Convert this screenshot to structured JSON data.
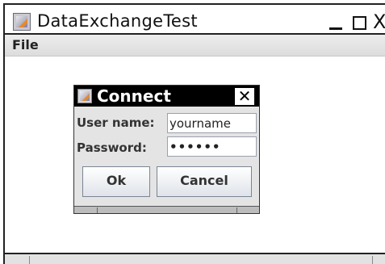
{
  "window": {
    "title": "DataExchangeTest",
    "close_glyph": "X",
    "controls": [
      "minimize-icon",
      "maximize-icon",
      "close-icon"
    ]
  },
  "menubar": {
    "items": [
      {
        "label": "File"
      }
    ]
  },
  "dialog": {
    "title": "Connect",
    "close_glyph": "✕",
    "user_label": "User name:",
    "user_value": "yourname",
    "password_label": "Password:",
    "password_value": "••••••",
    "ok_label": "Ok",
    "cancel_label": "Cancel"
  }
}
